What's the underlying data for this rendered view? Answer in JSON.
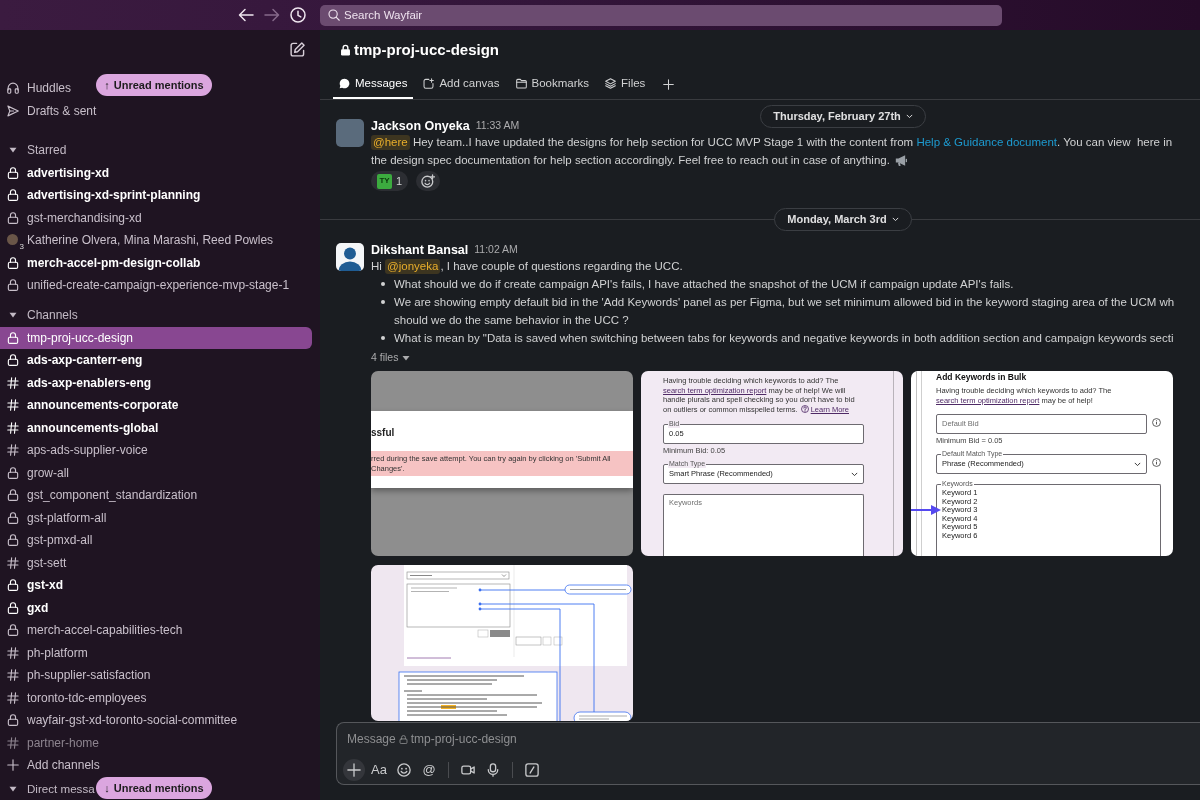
{
  "topbar": {
    "nav": [
      {
        "kind": "back",
        "disabled": false
      },
      {
        "kind": "forward",
        "disabled": true
      },
      {
        "kind": "history",
        "disabled": false
      }
    ],
    "search": {
      "placeholder": "Search Wayfair"
    }
  },
  "sidebar": {
    "nav": [
      {
        "kind": "huddles",
        "label": "Huddles"
      },
      {
        "kind": "drafts",
        "label": "Drafts & sent"
      }
    ],
    "sections": [
      {
        "title": "Starred",
        "expanded": true,
        "items": [
          {
            "label": "advertising-xd",
            "kind": "private",
            "unread": true,
            "selected": false,
            "muted": false
          },
          {
            "label": "advertising-xd-sprint-planning",
            "kind": "private",
            "unread": true,
            "selected": false,
            "muted": false
          },
          {
            "label": "gst-merchandising-xd",
            "kind": "private",
            "unread": false,
            "selected": false,
            "muted": false
          },
          {
            "label": "Katherine Olvera, Mina Marashi, Reed Powles",
            "kind": "group",
            "member_count": "3",
            "unread": false,
            "selected": false,
            "muted": false
          },
          {
            "label": "merch-accel-pm-design-collab",
            "kind": "private",
            "unread": true,
            "selected": false,
            "muted": false
          },
          {
            "label": "unified-create-campaign-experience-mvp-stage-1",
            "kind": "private",
            "unread": false,
            "selected": false,
            "muted": false
          }
        ]
      },
      {
        "title": "Channels",
        "expanded": true,
        "items": [
          {
            "label": "tmp-proj-ucc-design",
            "kind": "private",
            "unread": false,
            "selected": true,
            "muted": false
          },
          {
            "label": "ads-axp-canterr-eng",
            "kind": "private",
            "unread": true,
            "selected": false,
            "muted": false
          },
          {
            "label": "ads-axp-enablers-eng",
            "kind": "public",
            "unread": true,
            "selected": false,
            "muted": false
          },
          {
            "label": "announcements-corporate",
            "kind": "public",
            "unread": true,
            "selected": false,
            "muted": false
          },
          {
            "label": "announcements-global",
            "kind": "public",
            "unread": true,
            "selected": false,
            "muted": false
          },
          {
            "label": "aps-ads-supplier-voice",
            "kind": "public",
            "unread": false,
            "selected": false,
            "muted": false
          },
          {
            "label": "grow-all",
            "kind": "private",
            "unread": false,
            "selected": false,
            "muted": false
          },
          {
            "label": "gst_component_standardization",
            "kind": "private",
            "unread": false,
            "selected": false,
            "muted": false
          },
          {
            "label": "gst-platform-all",
            "kind": "private",
            "unread": false,
            "selected": false,
            "muted": false
          },
          {
            "label": "gst-pmxd-all",
            "kind": "private",
            "unread": false,
            "selected": false,
            "muted": false
          },
          {
            "label": "gst-sett",
            "kind": "public",
            "unread": false,
            "selected": false,
            "muted": false
          },
          {
            "label": "gst-xd",
            "kind": "private",
            "unread": true,
            "selected": false,
            "muted": false
          },
          {
            "label": "gxd",
            "kind": "private",
            "unread": true,
            "selected": false,
            "muted": false
          },
          {
            "label": "merch-accel-capabilities-tech",
            "kind": "private",
            "unread": false,
            "selected": false,
            "muted": false
          },
          {
            "label": "ph-platform",
            "kind": "public",
            "unread": false,
            "selected": false,
            "muted": false
          },
          {
            "label": "ph-supplier-satisfaction",
            "kind": "public",
            "unread": false,
            "selected": false,
            "muted": false
          },
          {
            "label": "toronto-tdc-employees",
            "kind": "public",
            "unread": false,
            "selected": false,
            "muted": false
          },
          {
            "label": "wayfair-gst-xd-toronto-social-committee",
            "kind": "private",
            "unread": false,
            "selected": false,
            "muted": false
          },
          {
            "label": "partner-home",
            "kind": "public",
            "unread": false,
            "selected": false,
            "muted": true
          }
        ]
      }
    ],
    "add_channels": {
      "label": "Add channels"
    },
    "dm_section": {
      "title": "Direct messa",
      "expanded": true
    },
    "unread_pills": [
      {
        "label": "Unread mentions",
        "arrow": "↑"
      },
      {
        "label": "Unread mentions",
        "arrow": "↓"
      }
    ]
  },
  "main": {
    "channel": {
      "name": "tmp-proj-ucc-design",
      "private": true
    },
    "tabs": [
      {
        "kind": "messages",
        "label": "Messages",
        "selected": true
      },
      {
        "kind": "canvas",
        "label": "Add canvas",
        "selected": false
      },
      {
        "kind": "bookmarks",
        "label": "Bookmarks",
        "selected": false
      },
      {
        "kind": "files",
        "label": "Files",
        "selected": false
      }
    ],
    "messages": [
      {
        "date": {
          "label": "Thursday, February 27th",
          "sticky": true
        },
        "author": "Jackson Onyeka",
        "time": "11:33 AM",
        "avatar": {
          "kind": "photo"
        },
        "lines": [
          [
            {
              "kind": "mention",
              "text": "@here"
            },
            {
              "kind": "text",
              "text": " Hey team..I have updated the designs for help section for UCC MVP Stage 1 with the content from "
            },
            {
              "kind": "link",
              "text": "Help & Guidance document"
            },
            {
              "kind": "text",
              "text": ". You can view  here in"
            }
          ],
          [
            {
              "kind": "text",
              "text": "the design spec documentation for help section accordingly. Feel free to reach out in case of anything. "
            },
            {
              "kind": "emoji"
            }
          ]
        ],
        "reactions": [
          {
            "emoji": "TY",
            "count": "1"
          }
        ]
      },
      {
        "date": {
          "label": "Monday, March 3rd",
          "sticky": false
        },
        "author": "Dikshant Bansal",
        "time": "11:02 AM",
        "avatar": {
          "kind": "default"
        },
        "lines": [
          [
            {
              "kind": "text",
              "text": "Hi "
            },
            {
              "kind": "mention",
              "text": "@jonyeka"
            },
            {
              "kind": "text",
              "text": ", I have couple of questions regarding the UCC."
            }
          ]
        ],
        "bullets": [
          [
            "What should we do if create campaign API's fails, I have attached the snapshot of the UCM if campaign update API's fails."
          ],
          [
            "We are showing empty default bid in the 'Add Keywords' panel as per Figma, but we set minimum allowed bid in the keyword staging area of the UCM wh",
            "should we do the same behavior in the UCC ?"
          ],
          [
            "What is mean by \"Data is saved when switching between tabs for keywords and negative keywords in both addition section and campaign keywords secti"
          ]
        ],
        "files_toggle": {
          "label": "4 files",
          "expanded": true
        },
        "files": [
          {
            "kind": "error_dialog",
            "title": "ssful",
            "message": "rred during the save attempt. You can try again by clicking on 'Submit All Changes'."
          },
          {
            "kind": "form_panel",
            "intro": "Having trouble deciding which keywords to add? The ",
            "intro_link": "search term optimization report",
            "intro_rest": " may be of help! We will handle plurals and spell checking so you don't have to bid on outliers or common misspelled terms.",
            "learn_more": "Learn More",
            "fields": [
              {
                "kind": "input",
                "label": "Bid",
                "value": "0.05"
              },
              {
                "kind": "note",
                "text": "Minimum Bid: 0.05"
              },
              {
                "kind": "select",
                "label": "Match Type",
                "value": "Smart Phrase (Recommended)"
              },
              {
                "kind": "textarea",
                "placeholder": "Keywords"
              }
            ]
          },
          {
            "kind": "form_page",
            "heading": "Add Keywords in Bulk",
            "intro": "Having trouble deciding which keywords to add? The ",
            "intro_link": "search term optimization report",
            "intro_rest": " may be of help!",
            "fields": [
              {
                "kind": "input",
                "placeholder": "Default Bid",
                "info": true
              },
              {
                "kind": "note",
                "text": "Minimum Bid = 0.05"
              },
              {
                "kind": "select",
                "label": "Default Match Type",
                "value": "Phrase (Recommended)",
                "info": true
              },
              {
                "kind": "textarea",
                "label": "Keywords",
                "lines": [
                  "Keyword 1",
                  "Keyword 2",
                  "Keyword 3",
                  "Keyword 4",
                  "Keyword 5",
                  "Keyword 6"
                ]
              }
            ],
            "pointer_arrow": true
          },
          {
            "kind": "annotated_spec"
          }
        ]
      }
    ],
    "composer": {
      "placeholder": "Message",
      "channel": "tmp-proj-ucc-design",
      "tools": [
        {
          "kind": "attach"
        },
        {
          "kind": "format",
          "label": "Aa"
        },
        {
          "kind": "emoji"
        },
        {
          "kind": "mention",
          "label": "@"
        },
        {
          "kind": "divider"
        },
        {
          "kind": "video"
        },
        {
          "kind": "audio"
        },
        {
          "kind": "divider"
        },
        {
          "kind": "shortcut"
        }
      ]
    }
  }
}
